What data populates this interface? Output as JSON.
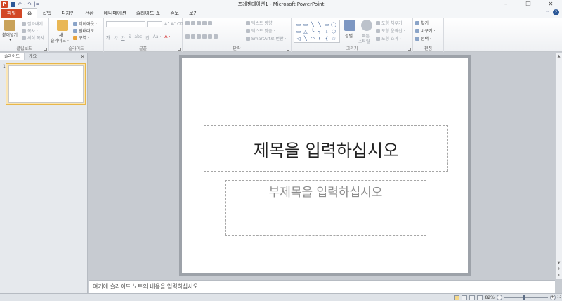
{
  "window": {
    "title": "프레젠테이션1 - Microsoft PowerPoint",
    "app_icon": "P",
    "controls": [
      "–",
      "❐",
      "✕"
    ]
  },
  "qat": {
    "save": "save-icon",
    "undo": "↶",
    "sep": "-",
    "redo": "↷",
    "more": "|="
  },
  "tabs": {
    "file": "파일",
    "items": [
      "홈",
      "삽입",
      "디자인",
      "전환",
      "애니메이션",
      "슬라이드 쇼",
      "검토",
      "보기"
    ],
    "active": "홈",
    "right_chevron": "⌃",
    "help": "?"
  },
  "ribbon": {
    "clipboard": {
      "label": "클립보드",
      "paste": "붙여넣기",
      "paste_arrow": "▾",
      "cut": "잘라내기",
      "copy": "복사 ·",
      "format_painter": "서식 복사"
    },
    "slides": {
      "label": "슬라이드",
      "new_slide_1": "새",
      "new_slide_2": "슬라이드 ·",
      "layout": "레이아웃 ·",
      "reset": "원래대로",
      "section": "구역 ·"
    },
    "font": {
      "label": "글꼴",
      "grow_shrink": "A˄ A˅",
      "clear": "⌫",
      "row2": [
        "가",
        "가",
        "가",
        "S",
        "abc",
        "간",
        "Aa ·",
        "A ·"
      ]
    },
    "paragraph": {
      "label": "단락",
      "text_direction": "텍스트 방향 ·",
      "align_text": "텍스트 맞춤 ·",
      "smartart": "SmartArt로 변환 ·"
    },
    "drawing": {
      "label": "그리기",
      "arrange": "정렬",
      "quick_styles_1": "빠른",
      "quick_styles_2": "스타일 ·",
      "shape_fill": "도형 채우기 ·",
      "shape_outline": "도형 윤곽선 ·",
      "shape_effects": "도형 효과 ·",
      "shapes": [
        "▭",
        "▭",
        "╲",
        "╲",
        "▭",
        "◯",
        "▭",
        "△",
        "╰",
        "╮",
        "⇩",
        "⬡",
        "◁",
        "╲",
        "◠",
        "(",
        "{",
        "☆"
      ]
    },
    "editing": {
      "label": "편집",
      "find": "찾기",
      "replace": "바꾸기 ·",
      "select": "선택 ·"
    }
  },
  "panel": {
    "tab_slides": "슬라이드",
    "tab_outline": "개요",
    "close": "✕",
    "slide_number": "1"
  },
  "slide": {
    "title_placeholder": "제목을 입력하십시오",
    "subtitle_placeholder": "부제목을 입력하십시오"
  },
  "notes": {
    "placeholder": "여기에 슬라이드 노트의 내용을 입력하십시오"
  },
  "scroll": {
    "up": "▲",
    "down": "▼",
    "page_up": "⇞",
    "page_down": "⇟"
  },
  "status": {
    "zoom_percent": "82%",
    "zoom_out": "−",
    "zoom_in": "+",
    "zoom_level": 0.82,
    "fit": "⛶"
  }
}
